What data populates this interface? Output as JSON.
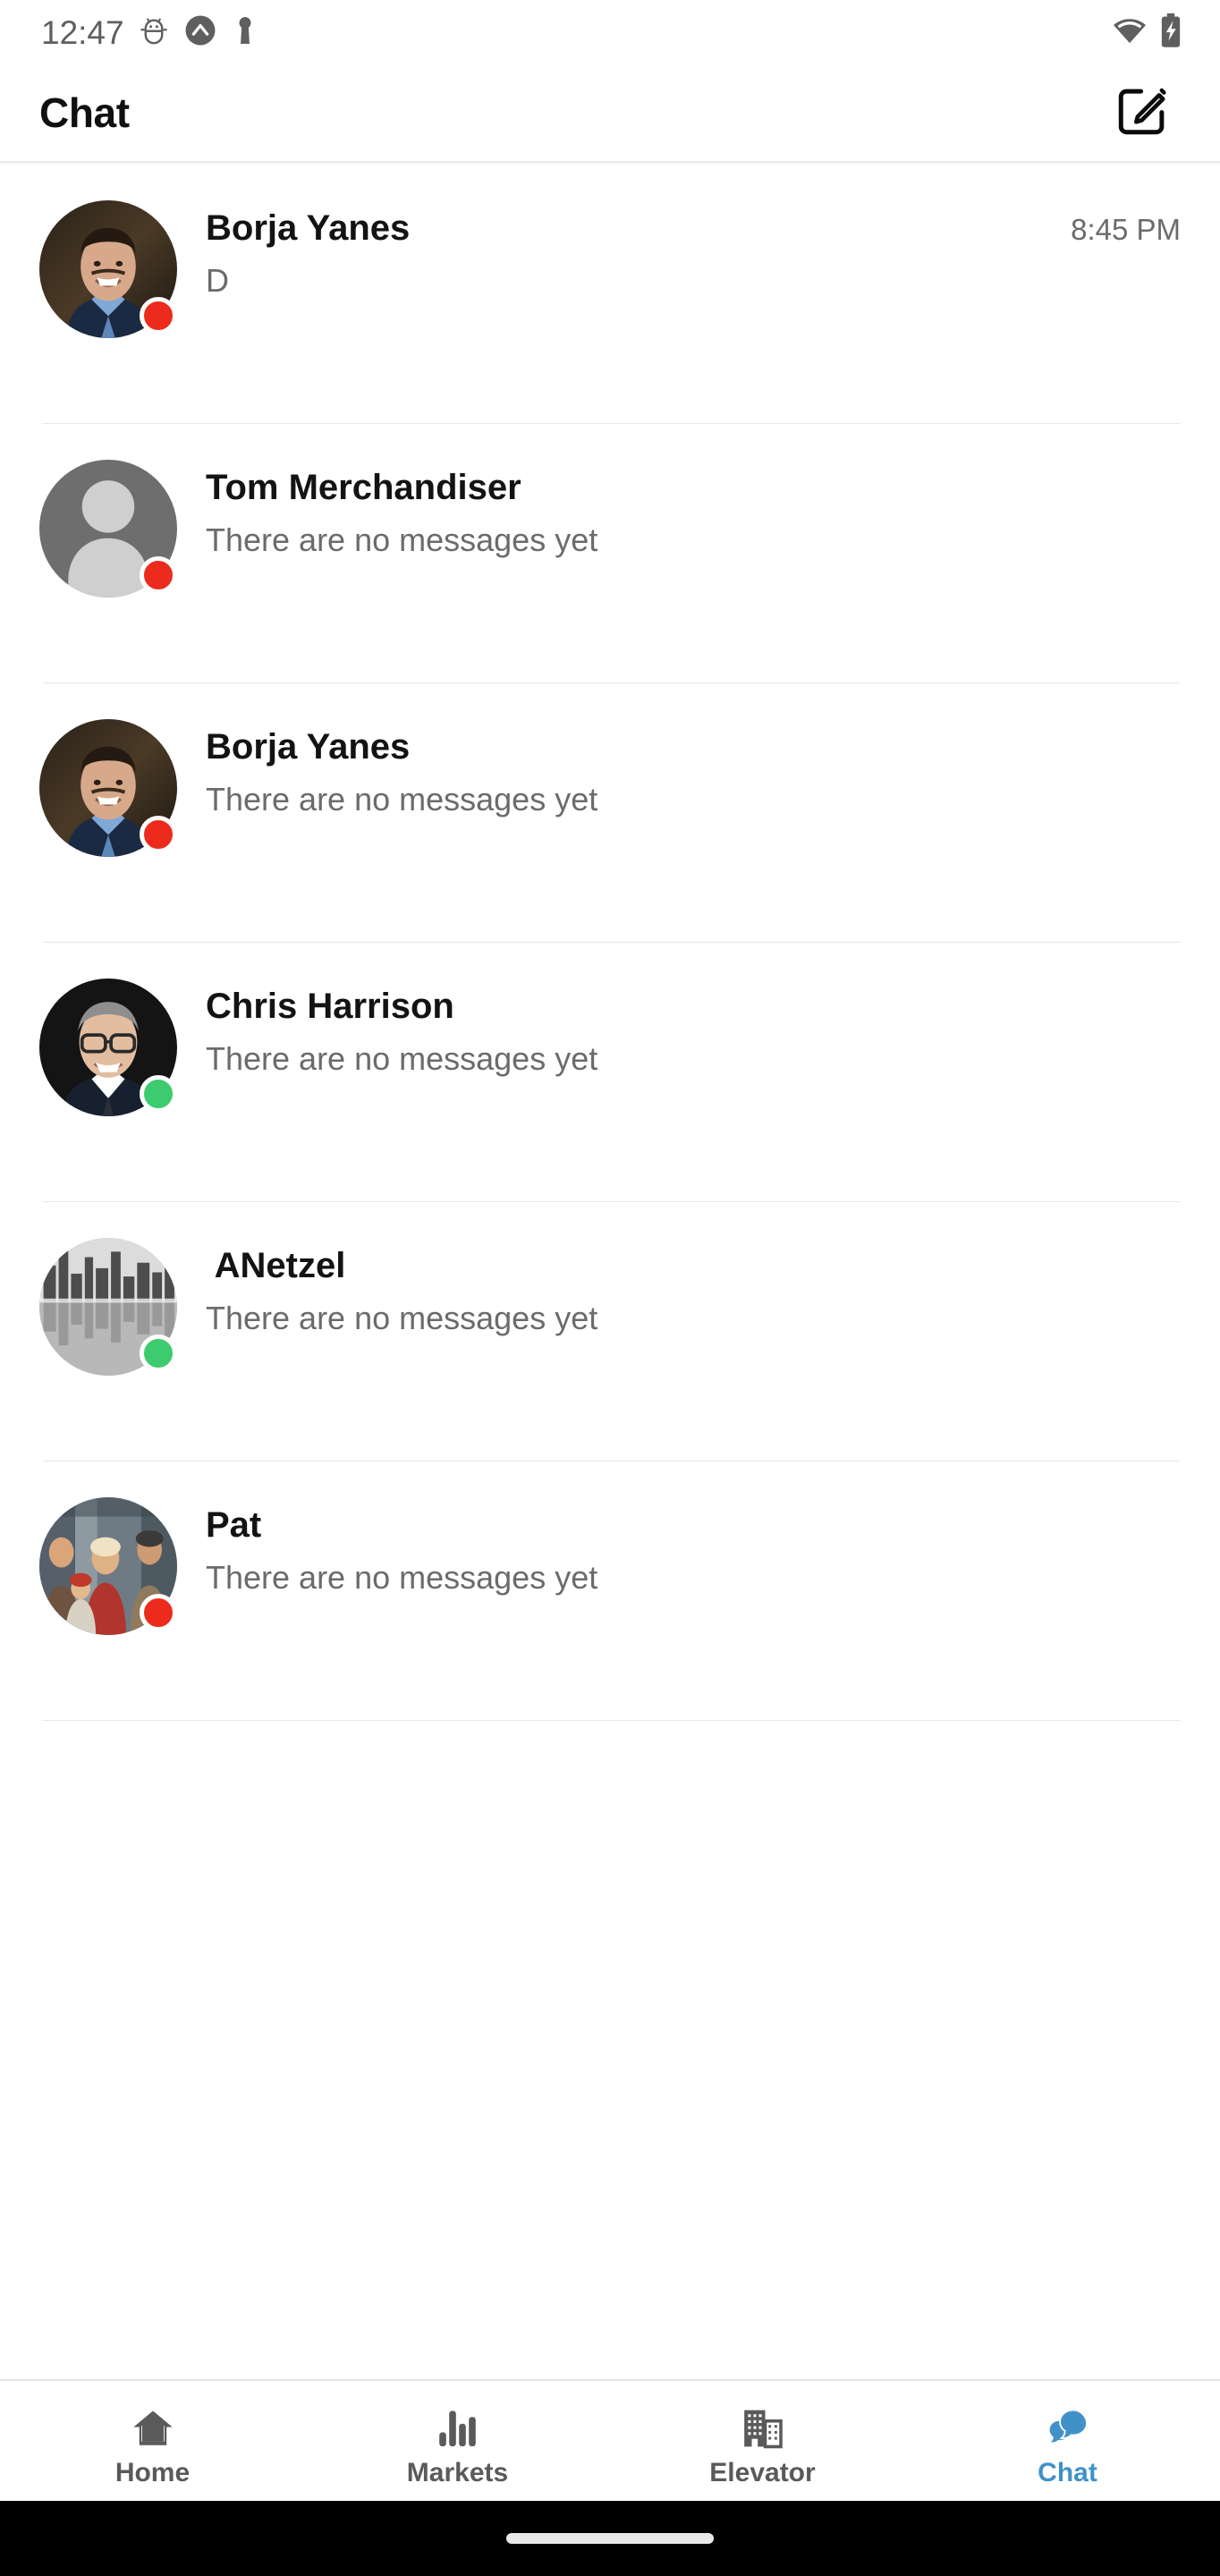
{
  "status_bar": {
    "time": "12:47",
    "left_icons": [
      {
        "name": "android-debug-icon"
      },
      {
        "name": "circle-chevron-up-icon"
      },
      {
        "name": "vpn-key-icon"
      }
    ],
    "right_icons": [
      {
        "name": "wifi-icon"
      },
      {
        "name": "battery-charging-icon"
      }
    ]
  },
  "header": {
    "title": "Chat",
    "compose_icon": "compose-icon"
  },
  "colors": {
    "accent": "#4191c9",
    "status_online": "#3ccb6e",
    "status_offline": "#ec2b1d",
    "title_text": "#131313",
    "secondary_text": "#6b6b6b",
    "divider": "#e8e8e8",
    "nav_inactive": "#5a5a5a"
  },
  "chat_list": {
    "items": [
      {
        "name": "Borja Yanes",
        "preview": "D",
        "time": "8:45 PM",
        "status": "offline",
        "avatar_type": "photo-man-blue-shirt"
      },
      {
        "name": "Tom Merchandiser",
        "preview": "There are no messages yet",
        "time": "",
        "status": "offline",
        "avatar_type": "placeholder-person"
      },
      {
        "name": "Borja Yanes",
        "preview": "There are no messages yet",
        "time": "",
        "status": "offline",
        "avatar_type": "photo-man-blue-shirt"
      },
      {
        "name": "Chris Harrison",
        "preview": "There are no messages yet",
        "time": "",
        "status": "online",
        "avatar_type": "photo-man-glasses"
      },
      {
        "name": " ANetzel",
        "preview": "There are no messages yet",
        "time": "",
        "status": "online",
        "avatar_type": "photo-city-skyline"
      },
      {
        "name": "Pat",
        "preview": "There are no messages yet",
        "time": "",
        "status": "offline",
        "avatar_type": "photo-group-people"
      }
    ]
  },
  "bottom_nav": {
    "items": [
      {
        "label": "Home",
        "icon": "home-icon",
        "active": false
      },
      {
        "label": "Markets",
        "icon": "bar-chart-icon",
        "active": false
      },
      {
        "label": "Elevator",
        "icon": "buildings-icon",
        "active": false
      },
      {
        "label": "Chat",
        "icon": "chat-bubbles-icon",
        "active": true
      }
    ]
  }
}
